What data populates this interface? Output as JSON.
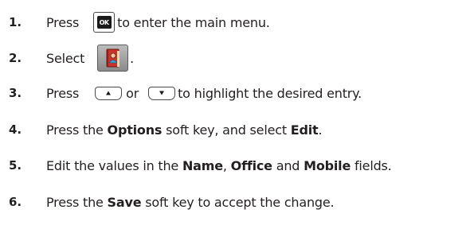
{
  "steps": [
    {
      "number": "1.",
      "before": "Press",
      "icon": "ok-key-icon",
      "icon_label": "OK",
      "after": "to enter the main menu."
    },
    {
      "number": "2.",
      "before": "Select",
      "icon": "directory-book-icon",
      "after": "."
    },
    {
      "number": "3.",
      "before": "Press",
      "icon1": "up-navigation-key-icon",
      "middle": "or",
      "icon2": "down-navigation-key-icon",
      "after": "to highlight the desired entry."
    },
    {
      "number": "4.",
      "segments": [
        "Press the ",
        "Options",
        " soft key",
        ", and select ",
        "Edit",
        "."
      ]
    },
    {
      "number": "5.",
      "segments": [
        "Edit the values in the ",
        "Name",
        ", ",
        "Office",
        " and ",
        "Mobile",
        " fields."
      ]
    },
    {
      "number": "6.",
      "segments": [
        "Press the ",
        "Save",
        " soft key to accept the change."
      ]
    }
  ],
  "colors": {
    "text": "#231f20",
    "book_red": "#c8342c",
    "person_blue": "#3aa0d8"
  }
}
